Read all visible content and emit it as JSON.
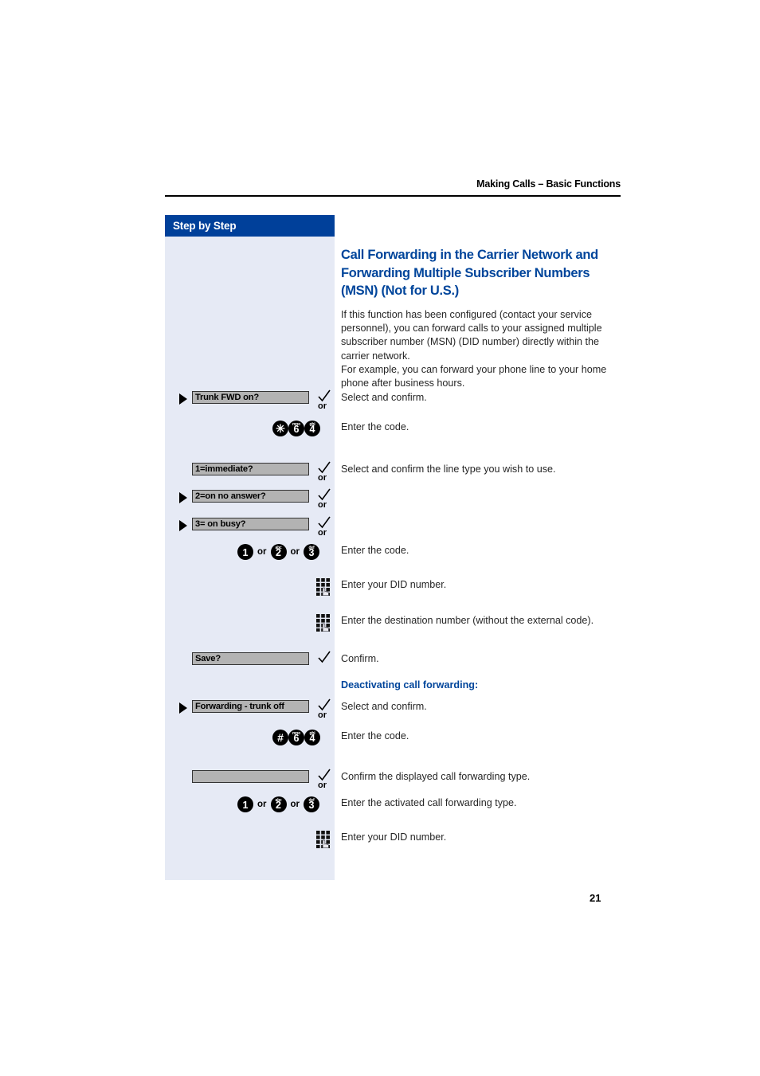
{
  "header": {
    "title": "Making Calls – Basic Functions"
  },
  "sidebar": {
    "label": "Step by Step"
  },
  "section": {
    "title": "Call Forwarding in the Carrier Network and Forwarding Multiple Subscriber Numbers (MSN) (Not for U.S.)",
    "intro": "If this function has been configured (contact your service personnel), you can forward calls to your assigned multiple subscriber number (MSN) (DID number) directly within the carrier network.\nFor example, you can forward your phone line to your home phone after business hours."
  },
  "steps": {
    "trunk_fwd_on": {
      "display": "Trunk FWD on?",
      "text": "Select and confirm.",
      "or": "or"
    },
    "code_star_6_4": {
      "text": "Enter the code.",
      "keys": [
        {
          "glyph": "✳",
          "digit": "",
          "letters": ""
        },
        {
          "glyph": "",
          "digit": "6",
          "letters": "mno"
        },
        {
          "glyph": "",
          "digit": "4",
          "letters": "ghi"
        }
      ]
    },
    "immediate": {
      "display": "1=immediate?",
      "text": "Select and confirm the line type you wish to use.",
      "or": "or"
    },
    "no_answer": {
      "display": "2=on no answer?",
      "or": "or"
    },
    "on_busy": {
      "display": "3= on busy?",
      "or": "or"
    },
    "code_1_2_3": {
      "text": "Enter the code.",
      "separator": "or",
      "keys": [
        {
          "digit": "1",
          "letters": ""
        },
        {
          "digit": "2",
          "letters": "abc"
        },
        {
          "digit": "3",
          "letters": "def"
        }
      ]
    },
    "did_number": {
      "text": "Enter your DID number.",
      "icon": "dialpad-icon"
    },
    "destination_number": {
      "text": "Enter the destination number (without the external code).",
      "icon": "dialpad-icon"
    },
    "save": {
      "display": "Save?",
      "text": "Confirm."
    },
    "deactivating_heading": {
      "text": "Deactivating call forwarding:"
    },
    "forwarding_trunk_off": {
      "display": "Forwarding - trunk off",
      "text": "Select and confirm.",
      "or": "or"
    },
    "code_hash_6_4": {
      "text": "Enter the code.",
      "keys": [
        {
          "glyph": "#",
          "digit": "",
          "letters": ""
        },
        {
          "glyph": "",
          "digit": "6",
          "letters": "mno"
        },
        {
          "glyph": "",
          "digit": "4",
          "letters": "ghi"
        }
      ]
    },
    "confirm_displayed": {
      "display": "",
      "text": "Confirm the displayed call forwarding type.",
      "or": "or"
    },
    "activated_type": {
      "text": "Enter the activated call forwarding type.",
      "separator": "or",
      "keys": [
        {
          "digit": "1",
          "letters": ""
        },
        {
          "digit": "2",
          "letters": "abc"
        },
        {
          "digit": "3",
          "letters": "def"
        }
      ]
    },
    "did_number_2": {
      "text": "Enter your DID number.",
      "icon": "dialpad-icon"
    }
  },
  "footer": {
    "page_number": "21"
  }
}
